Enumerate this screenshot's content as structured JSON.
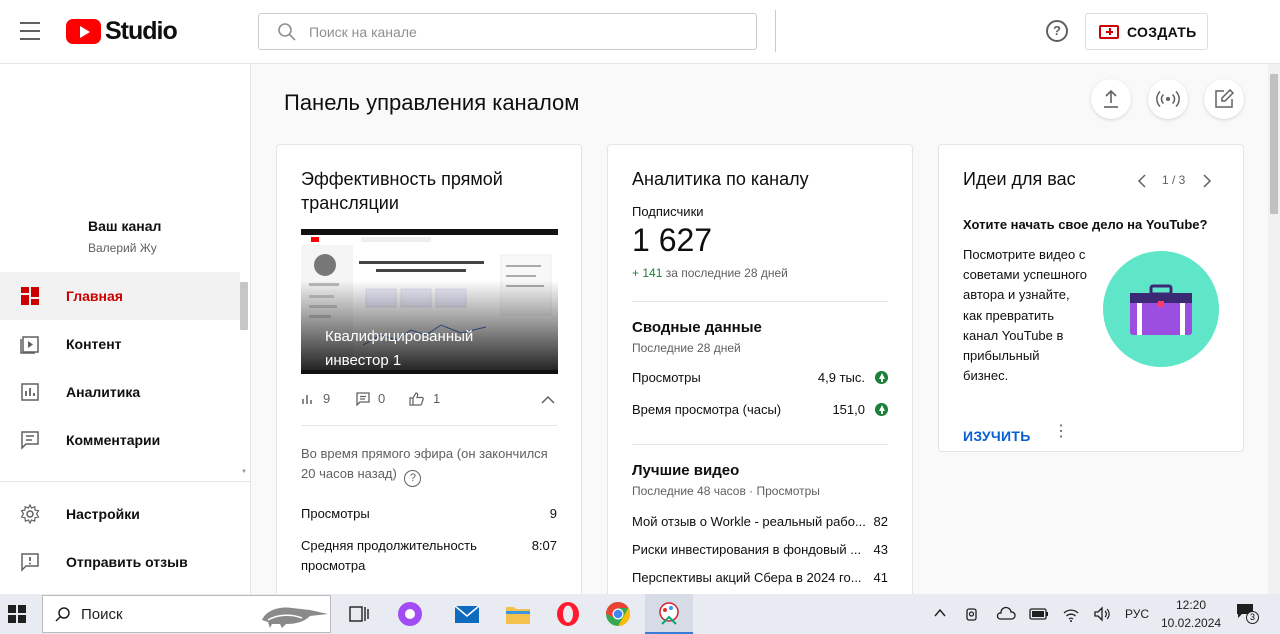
{
  "header": {
    "logo_text": "Studio",
    "search_placeholder": "Поиск на канале",
    "create_label": "СОЗДАТЬ",
    "help_symbol": "?"
  },
  "sidebar": {
    "channel_name": "Ваш канал",
    "channel_user": "Валерий Жу",
    "items": [
      {
        "label": "Главная",
        "icon": "dashboard-icon",
        "active": true
      },
      {
        "label": "Контент",
        "icon": "content-icon",
        "active": false
      },
      {
        "label": "Аналитика",
        "icon": "analytics-icon",
        "active": false
      },
      {
        "label": "Комментарии",
        "icon": "comments-icon",
        "active": false
      }
    ],
    "bottom_items": [
      {
        "label": "Настройки",
        "icon": "gear-icon"
      },
      {
        "label": "Отправить отзыв",
        "icon": "feedback-icon"
      }
    ]
  },
  "main": {
    "page_title": "Панель управления каналом"
  },
  "live_card": {
    "title": "Эффективность прямой трансляции",
    "thumbnail_title": "Квалифицированный инвестор 1",
    "views": "9",
    "comments": "0",
    "likes": "1",
    "note": "Во время прямого эфира (он закончился 20 часов назад)",
    "stats": [
      {
        "label": "Просмотры",
        "value": "9"
      },
      {
        "label": "Средняя продолжительность просмотра",
        "value": "8:07"
      }
    ]
  },
  "analytics_card": {
    "title": "Аналитика по каналу",
    "subscribers_label": "Подписчики",
    "subscribers_value": "1 627",
    "subscribers_delta": "+ 141",
    "subscribers_delta_period": "за последние 28 дней",
    "summary_title": "Сводные данные",
    "summary_period": "Последние 28 дней",
    "summary_rows": [
      {
        "label": "Просмотры",
        "value": "4,9 тыс."
      },
      {
        "label": "Время просмотра (часы)",
        "value": "151,0"
      }
    ],
    "top_title": "Лучшие видео",
    "top_period": "Последние 48 часов · Просмотры",
    "top_videos": [
      {
        "title": "Мой отзыв о Workle - реальный рабо...",
        "views": "82"
      },
      {
        "title": "Риски инвестирования в фондовый ...",
        "views": "43"
      },
      {
        "title": "Перспективы акций Сбера в 2024 го...",
        "views": "41"
      }
    ]
  },
  "ideas_card": {
    "title": "Идеи для вас",
    "pager": "1 / 3",
    "heading": "Хотите начать свое дело на YouTube?",
    "body": "Посмотрите видео с советами успешного автора и узнайте, как превратить канал YouTube в прибыльный бизнес.",
    "action": "ИЗУЧИТЬ"
  },
  "taskbar": {
    "search_label": "Поиск",
    "language": "РУС",
    "time": "12:20",
    "date": "10.02.2024",
    "notifications": "3"
  },
  "colors": {
    "brand_red": "#ff0000",
    "active_red": "#cc0000",
    "link_blue": "#065fd4",
    "positive_green": "#188038",
    "teal_circle": "#5fe6c8"
  }
}
